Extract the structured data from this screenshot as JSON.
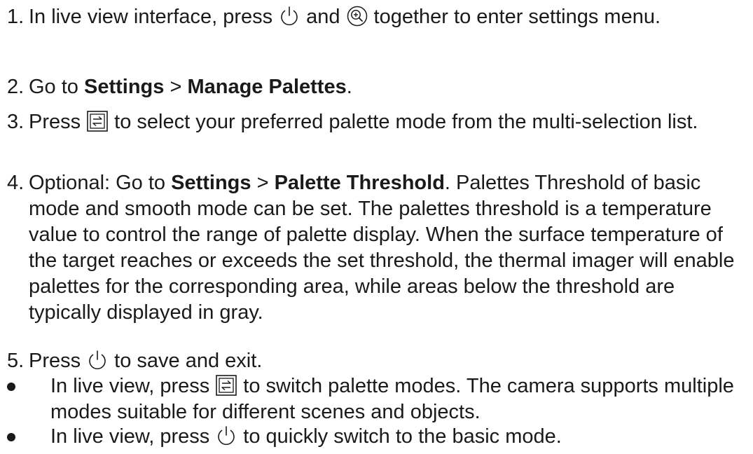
{
  "steps": [
    {
      "num": "1.",
      "t1": "In live view interface, press",
      "t2": "and",
      "t3": "together to enter settings menu.",
      "icon1": "power-icon",
      "icon2": "zoom-in-icon"
    },
    {
      "num": "2.",
      "t1": "Go to",
      "b1": "Settings",
      "t2": ">",
      "b2": "Manage Palettes",
      "t3": "."
    },
    {
      "num": "3.",
      "t1": "Press",
      "t2": "to select your preferred palette mode from the multi-selection list.",
      "icon1": "palette-switch-icon"
    },
    {
      "num": "4.",
      "t1": "Optional: Go to",
      "b1": "Settings",
      "t2": ">",
      "b2": "Palette Threshold",
      "t3": ". Palettes Threshold of basic mode and smooth mode can be set. The palettes threshold is a temperature value to control the range of palette display. When the surface temperature of the target reaches or exceeds the set threshold, the thermal imager will enable palettes for the corresponding area, while areas below the threshold are typically displayed in gray."
    },
    {
      "num": "5.",
      "t1": "Press",
      "t2": "to save and exit.",
      "icon1": "power-icon"
    }
  ],
  "bullets": [
    {
      "t1": "In live view, press",
      "t2": "to switch palette modes. The camera supports multiple modes suitable for different scenes and objects.",
      "icon1": "palette-switch-icon"
    },
    {
      "t1": "In live view, press",
      "t2": "to quickly switch to the basic mode.",
      "icon1": "power-icon"
    }
  ]
}
